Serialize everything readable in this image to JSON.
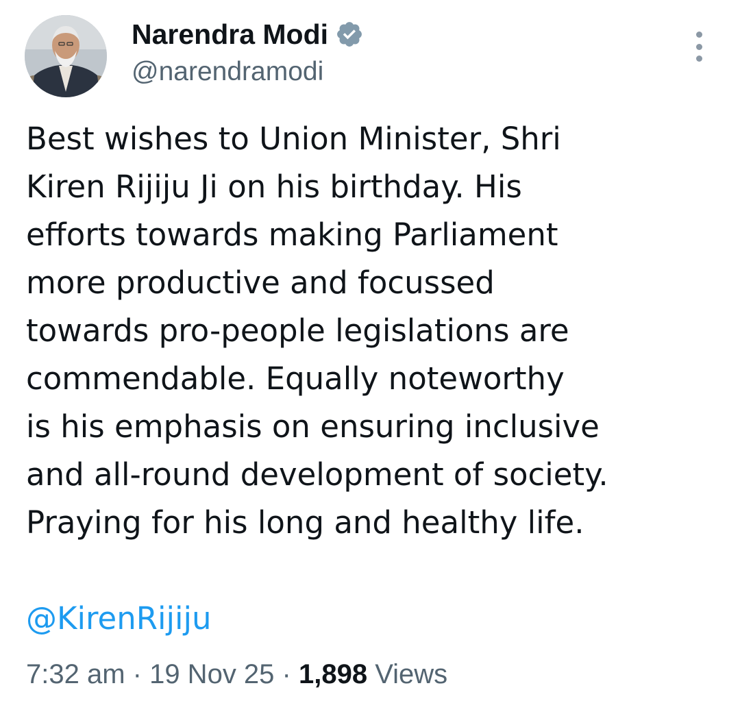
{
  "author": {
    "display_name": "Narendra Modi",
    "handle": "@narendramodi",
    "verified": true,
    "avatar_icon": "profile-photo"
  },
  "icons": {
    "verified": "verified-badge-icon",
    "more": "more-options-icon"
  },
  "tweet": {
    "lines": [
      "Best wishes to Union Minister, Shri",
      "Kiren Rijiju Ji on his birthday. His",
      "efforts towards making Parliament",
      "more productive and focussed",
      "towards pro-people legislations are",
      "commendable. Equally noteworthy",
      "is his emphasis on ensuring inclusive",
      "and all-round development of society.",
      "Praying for his long and healthy life."
    ],
    "mention": "@KirenRijiju"
  },
  "meta": {
    "time": "7:32 am",
    "separator": " · ",
    "date": "19 Nov 25",
    "views_count": "1,898",
    "views_label": "Views"
  },
  "colors": {
    "text": "#0f1419",
    "secondary": "#536471",
    "link": "#1d9bf0",
    "verified_badge": "#829aab"
  }
}
